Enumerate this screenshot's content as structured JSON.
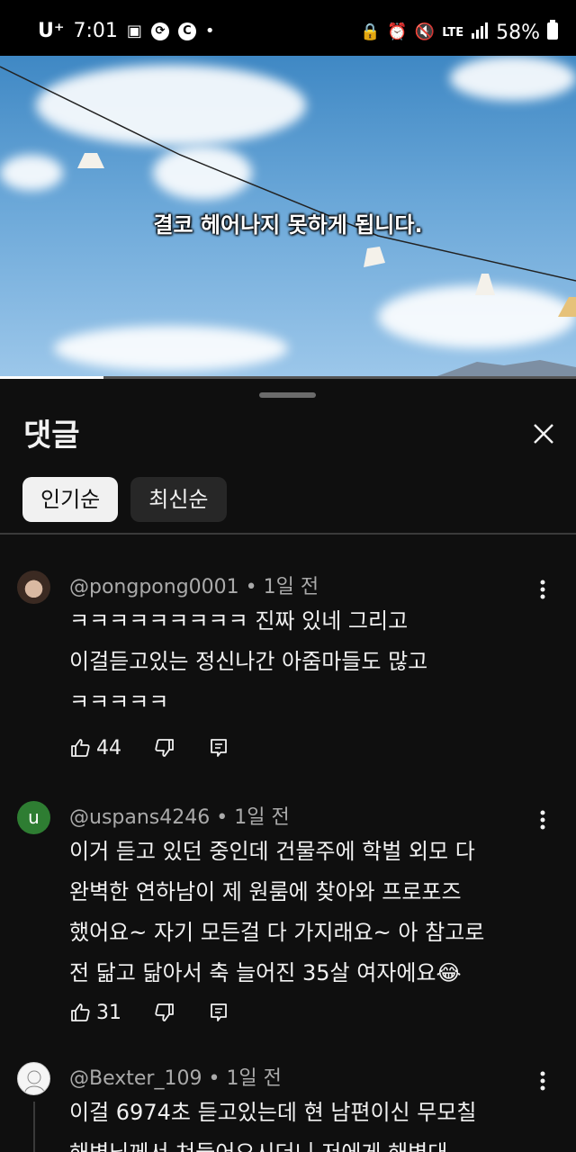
{
  "status_bar": {
    "carrier": "U⁺",
    "time": "7:01",
    "network": "LTE",
    "battery": "58%"
  },
  "video": {
    "subtitle": "결코 헤어나지 못하게 됩니다.",
    "progress": 0.18
  },
  "comments_panel": {
    "title": "댓글",
    "sort_tabs": [
      {
        "label": "인기순",
        "active": true
      },
      {
        "label": "최신순",
        "active": false
      }
    ],
    "comments": [
      {
        "author": "@pongpong0001",
        "time": "1일 전",
        "lines": [
          "ㅋㅋㅋㅋㅋㅋㅋㅋㅋ 진짜 있네 그리고",
          "이걸듣고있는 정신나간 아줌마들도 많고",
          "ㅋㅋㅋㅋㅋ"
        ],
        "likes": "44",
        "avatar_letter": ""
      },
      {
        "author": "@uspans4246",
        "time": "1일 전",
        "lines": [
          "이거 듣고 있던 중인데 건물주에 학벌 외모 다",
          "완벽한 연하남이 제 원룸에 찾아와 프로포즈",
          "했어요~ 자기 모든걸 다 가지래요~ 아 참고로",
          "전 닮고 닮아서 축 늘어진 35살 여자에요😂"
        ],
        "likes": "31",
        "avatar_letter": "u"
      },
      {
        "author": "@Bexter_109",
        "time": "1일 전",
        "lines": [
          "이걸 6974초 듣고있는데 현 남편이신 무모칠",
          "해병님께서 쳐들어오시더니 저에게 해병대"
        ],
        "likes": "",
        "avatar_letter": ""
      }
    ]
  },
  "colors": {
    "background": "#0f0f0f",
    "chip_active": "#f1f1f1",
    "chip": "#272727",
    "meta": "#aaaaaa",
    "avatar_u": "#2e7d32"
  }
}
